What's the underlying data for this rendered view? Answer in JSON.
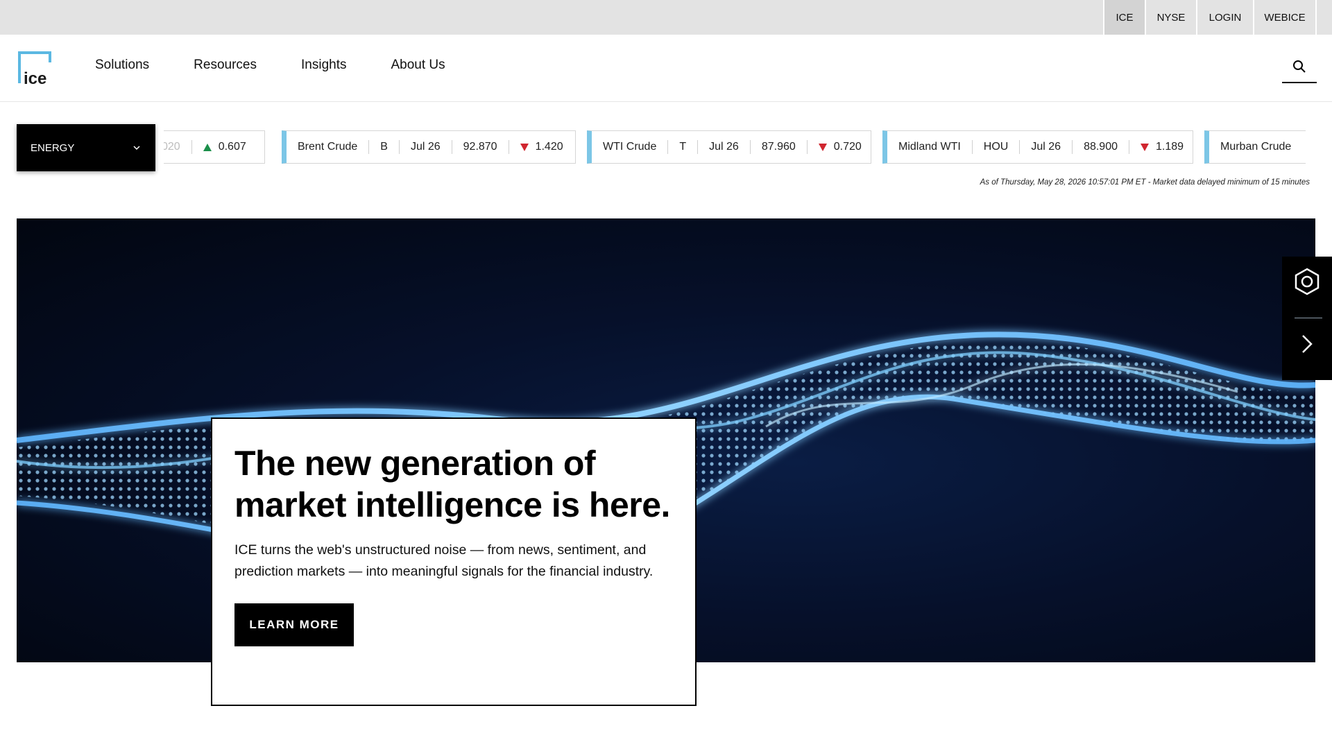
{
  "utility_nav": {
    "links": [
      {
        "label": "ICE",
        "active": true
      },
      {
        "label": "NYSE",
        "active": false
      },
      {
        "label": "LOGIN",
        "active": false
      },
      {
        "label": "WEBICE",
        "active": false
      }
    ]
  },
  "header": {
    "logo_text": "ice",
    "nav": [
      "Solutions",
      "Resources",
      "Insights",
      "About Us"
    ],
    "search_icon": "search-icon"
  },
  "ticker": {
    "market_select": "ENERGY",
    "items": [
      {
        "name": "",
        "symbol": "",
        "contract": "",
        "price": "020",
        "direction": "up",
        "change": "0.607"
      },
      {
        "name": "Brent Crude",
        "symbol": "B",
        "contract": "Jul 26",
        "price": "92.870",
        "direction": "down",
        "change": "1.420"
      },
      {
        "name": "WTI Crude",
        "symbol": "T",
        "contract": "Jul 26",
        "price": "87.960",
        "direction": "down",
        "change": "0.720"
      },
      {
        "name": "Midland WTI",
        "symbol": "HOU",
        "contract": "Jul 26",
        "price": "88.900",
        "direction": "down",
        "change": "1.189"
      },
      {
        "name": "Murban Crude",
        "symbol": "",
        "contract": "",
        "price": "",
        "direction": "",
        "change": ""
      }
    ],
    "as_of": "As of Thursday, May 28, 2026 10:57:01 PM ET - Market data delayed minimum of 15 minutes"
  },
  "hero": {
    "title": "The new generation of market intelligence is here.",
    "description": "ICE turns the web's unstructured noise — from news, sentiment, and prediction markets — into meaningful signals for the financial industry.",
    "cta": "LEARN MORE"
  },
  "side_widget": {
    "icons": [
      "hexagon-icon",
      "chevron-right-icon"
    ]
  },
  "colors": {
    "accent": "#7cc6e6",
    "up": "#1b8f4a",
    "down": "#d0262f",
    "utility_bg": "#e3e3e3"
  }
}
